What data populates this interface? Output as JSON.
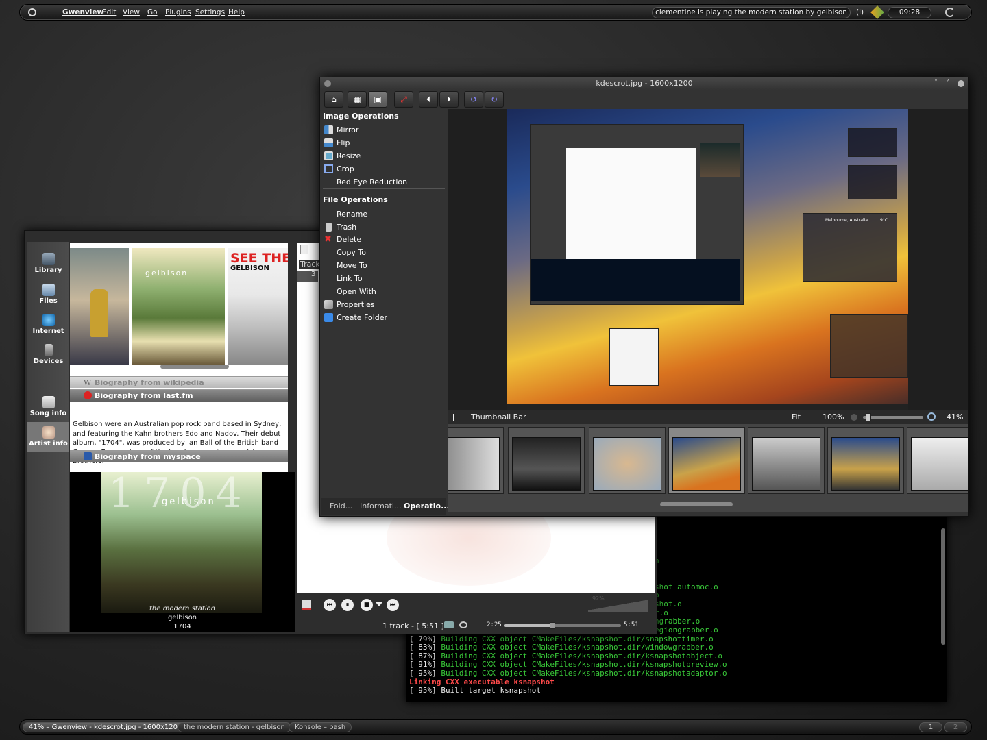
{
  "top_panel": {
    "menu": [
      "Gwenview",
      "Edit",
      "View",
      "Go",
      "Plugins",
      "Settings",
      "Help"
    ],
    "now_playing": "clementine is playing the modern station by gelbison",
    "clock": "09:28",
    "notify": "(i)"
  },
  "bottom_panel": {
    "tasks": [
      "41% – Gwenview - kdescrot.jpg - 1600x1200",
      "the modern station - gelbison",
      "Konsole – bash"
    ],
    "desktops": [
      "1",
      "2"
    ]
  },
  "gwenview": {
    "title": "kdescrot.jpg - 1600x1200",
    "image_ops_title": "Image Operations",
    "image_ops": [
      "Mirror",
      "Flip",
      "Resize",
      "Crop",
      "Red Eye Reduction"
    ],
    "file_ops_title": "File Operations",
    "file_ops": [
      "Rename",
      "Trash",
      "Delete",
      "Copy To",
      "Move To",
      "Link To",
      "Open With",
      "Properties",
      "Create Folder"
    ],
    "tabs": [
      "Fold...",
      "Informati...",
      "Operatio..."
    ],
    "thumbnail_bar": "Thumbnail Bar",
    "fit": "Fit",
    "zoom100": "100%",
    "zoom": "41%",
    "zoom_level": 0.41,
    "desktop_widget": {
      "city": "Melbourne, Australia",
      "temp": "9°C"
    }
  },
  "clementine": {
    "sidebar": [
      "Library",
      "Files",
      "Internet",
      "Devices",
      "Song info",
      "Artist info"
    ],
    "cover_text": "SEE THE",
    "cover_sub": "GELBISON",
    "bio_headers": [
      "Biography from wikipedia",
      "Biography from last.fm",
      "Biography from myspace"
    ],
    "bio_text": "Gelbison were an Australian pop rock band based in Sydney, and featuring the Kahn brothers Edo and Nadov. Their debut album, \"1704\", was produced by Ian Ball of the British band Gomez. Ex-members of the band now perform as Kahn Brothers.",
    "album_art_title": "1704",
    "album_art_band": "gelbison",
    "now_track": "the modern station",
    "now_artist": "gelbison",
    "now_album": "1704",
    "playlist_header": "Track",
    "playlist_row": "3",
    "track_count": "1 track - [ 5:51 ]",
    "elapsed": "2:25",
    "total": "5:51",
    "progress": 0.41,
    "volume": "92%"
  },
  "konsole": {
    "partial": [
      {
        "t": "h",
        "c": "g"
      },
      {
        "t": "shot_automoc.o",
        "c": "g"
      },
      {
        "t": "o",
        "c": "g"
      },
      {
        "t": "shot.o",
        "c": "g"
      },
      {
        "t": "r.o",
        "c": "g"
      },
      {
        "t": "ngrabber.o",
        "c": "g"
      },
      {
        "t": "egiongrabber.o",
        "c": "g"
      }
    ],
    "lines": [
      {
        "pct": "[ 79%]",
        "t": " Building CXX object CMakeFiles/ksnapshot.dir/snapshottimer.o"
      },
      {
        "pct": "[ 83%]",
        "t": " Building CXX object CMakeFiles/ksnapshot.dir/windowgrabber.o"
      },
      {
        "pct": "[ 87%]",
        "t": " Building CXX object CMakeFiles/ksnapshot.dir/ksnapshotobject.o"
      },
      {
        "pct": "[ 91%]",
        "t": " Building CXX object CMakeFiles/ksnapshot.dir/ksnapshotpreview.o"
      },
      {
        "pct": "[ 95%]",
        "t": " Building CXX object CMakeFiles/ksnapshot.dir/ksnapshotadaptor.o"
      }
    ],
    "linking": "Linking CXX executable ksnapshot",
    "built": "[ 95%] Built target ksnapshot"
  }
}
